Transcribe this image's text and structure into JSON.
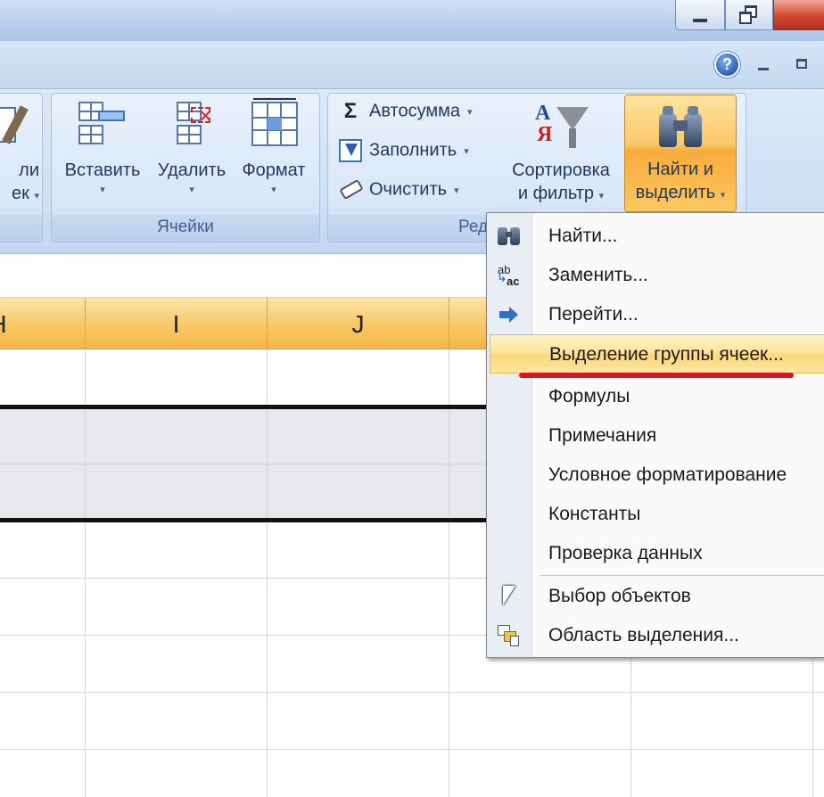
{
  "window": {
    "minimize_icon": "minimize-icon",
    "maximize_icon": "restore-icon",
    "close_icon": "close-icon"
  },
  "ribbon_top": {
    "help_glyph": "?",
    "help_icon": "help-icon"
  },
  "ribbon": {
    "left_partial": {
      "line1": "ли",
      "line2": "ек"
    },
    "cells_group": {
      "label": "Ячейки",
      "insert_label": "Вставить",
      "delete_label": "Удалить",
      "format_label": "Формат"
    },
    "edit_group": {
      "label_partial": "Ред",
      "autosum_label": "Автосумма",
      "autosum_symbol": "Σ",
      "fill_label": "Заполнить",
      "clear_label": "Очистить",
      "sort_label_line1": "Сортировка",
      "sort_label_line2": "и фильтр",
      "find_label_line1": "Найти и",
      "find_label_line2": "выделить"
    },
    "caret": "▾"
  },
  "sheet": {
    "columns": [
      "H",
      "I",
      "J"
    ],
    "partial_column": "H"
  },
  "menu": {
    "items": [
      {
        "label": "Найти...",
        "icon": "binoculars-icon"
      },
      {
        "label": "Заменить...",
        "icon": "replace-icon"
      },
      {
        "label": "Перейти...",
        "icon": "arrow-right-icon"
      },
      {
        "label": "Выделение группы ячеек...",
        "icon": ""
      },
      {
        "label": "Формулы",
        "icon": ""
      },
      {
        "label": "Примечания",
        "icon": ""
      },
      {
        "label": "Условное форматирование",
        "icon": ""
      },
      {
        "label": "Константы",
        "icon": ""
      },
      {
        "label": "Проверка данных",
        "icon": ""
      },
      {
        "label": "Выбор объектов",
        "icon": "cursor-arrow-icon"
      },
      {
        "label": "Область выделения...",
        "icon": "selection-pane-icon"
      }
    ],
    "replace_icon_text_top": "ab",
    "replace_icon_text_bottom": "ac",
    "highlight_color": "#fbd778",
    "underline_color": "#d8141c"
  }
}
